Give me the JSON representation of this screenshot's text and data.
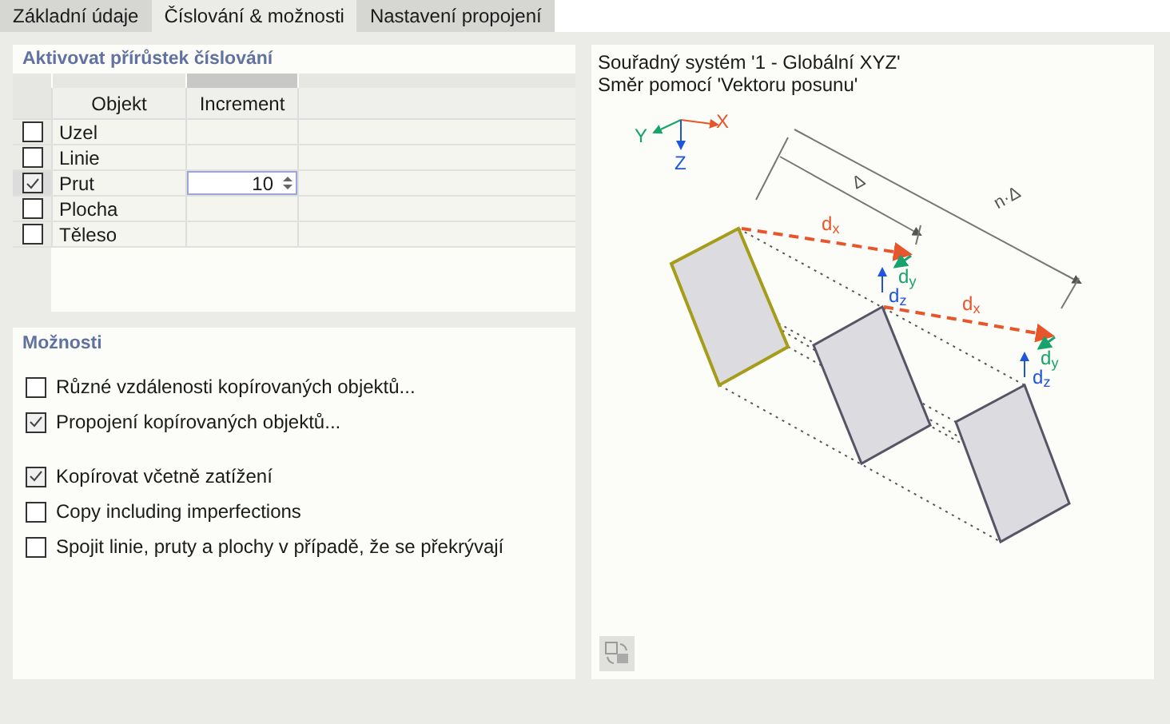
{
  "tabs": [
    {
      "label": "Základní údaje",
      "selected": false
    },
    {
      "label": "Číslování & možnosti",
      "selected": true
    },
    {
      "label": "Nastavení propojení",
      "selected": false
    }
  ],
  "numbering": {
    "title": "Aktivovat přírůstek číslování",
    "columns": [
      "Objekt",
      "Increment"
    ],
    "rows": [
      {
        "object": "Uzel",
        "checked": false
      },
      {
        "object": "Linie",
        "checked": false
      },
      {
        "object": "Prut",
        "checked": true,
        "increment": "10"
      },
      {
        "object": "Plocha",
        "checked": false
      },
      {
        "object": "Těleso",
        "checked": false
      }
    ]
  },
  "options": {
    "title": "Možnosti",
    "groups": [
      [
        {
          "label": "Různé vzdálenosti kopírovaných objektů...",
          "checked": false
        },
        {
          "label": "Propojení kopírovaných objektů...",
          "checked": true
        }
      ],
      [
        {
          "label": "Kopírovat včetně zatížení",
          "checked": true
        },
        {
          "label": "Copy including imperfections",
          "checked": false
        },
        {
          "label": "Spojit linie, pruty a plochy v případě, že se překrývají",
          "checked": false
        }
      ]
    ]
  },
  "diagram": {
    "lines": [
      "Souřadný systém '1 - Globální XYZ'",
      "Směr pomocí 'Vektoru posunu'"
    ],
    "axis_labels": [
      "X",
      "Y",
      "Z"
    ],
    "dimension_labels": [
      "Δ",
      "n·Δ"
    ],
    "vector_labels": [
      "d$_{x}$",
      "d$_{y}$",
      "d$_{z}$",
      "d$_{x}$",
      "d$_{y}$",
      "d$_{z}$"
    ]
  }
}
